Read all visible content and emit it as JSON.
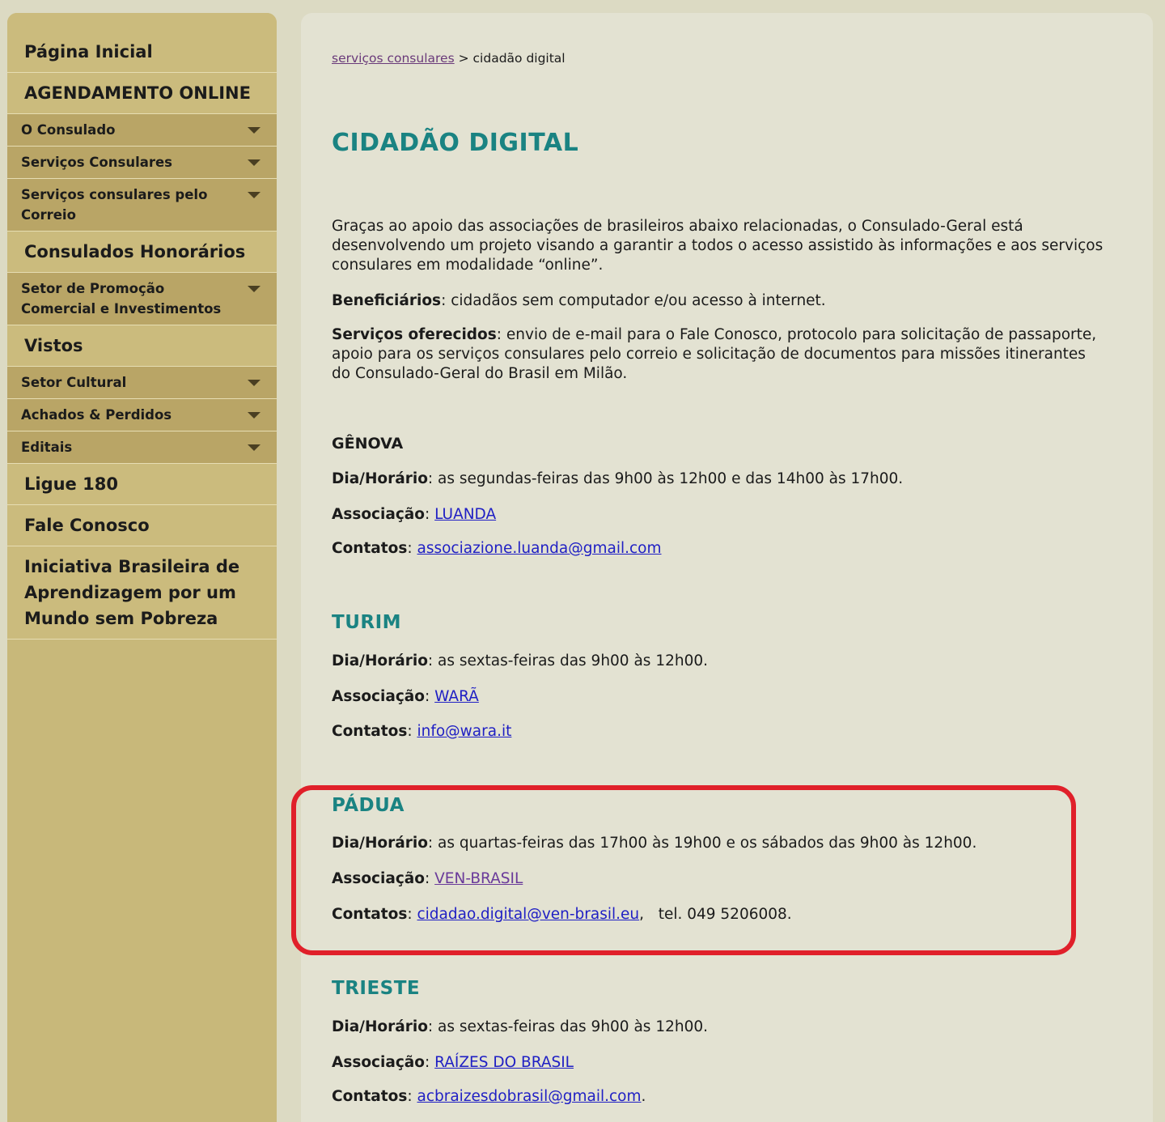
{
  "sidebar": {
    "items": [
      {
        "label": "Página Inicial",
        "type": "main"
      },
      {
        "label": "AGENDAMENTO ONLINE",
        "type": "main"
      },
      {
        "label": "O Consulado",
        "type": "sub"
      },
      {
        "label": "Serviços Consulares",
        "type": "sub"
      },
      {
        "label": "Serviços consulares pelo Correio",
        "type": "sub"
      },
      {
        "label": "Consulados Honorários",
        "type": "main"
      },
      {
        "label": "Setor de Promoção Comercial e Investimentos",
        "type": "sub"
      },
      {
        "label": "Vistos",
        "type": "main"
      },
      {
        "label": "Setor Cultural",
        "type": "sub"
      },
      {
        "label": "Achados & Perdidos",
        "type": "sub"
      },
      {
        "label": "Editais",
        "type": "sub"
      },
      {
        "label": "Ligue 180",
        "type": "main"
      },
      {
        "label": "Fale Conosco",
        "type": "main"
      },
      {
        "label": "Iniciativa Brasileira de Aprendizagem por um Mundo sem Pobreza",
        "type": "main"
      }
    ]
  },
  "breadcrumb": {
    "parent": "serviços consulares",
    "separator": ">",
    "current": "cidadão digital"
  },
  "page": {
    "title": "CIDADÃO DIGITAL",
    "intro": "Graças ao apoio das associações de brasileiros abaixo relacionadas, o Consulado-Geral está desenvolvendo um projeto visando a garantir a todos o acesso assistido às informações e aos serviços consulares em modalidade “online”.",
    "beneficiaries_label": "Beneficiários",
    "beneficiaries_text": "cidadãos sem computador e/ou acesso à internet.",
    "services_label": "Serviços oferecidos",
    "services_text": "envio de e-mail para o Fale Conosco, protocolo para solicitação de passaporte, apoio para os serviços consulares pelo correio e solicitação de documentos para missões itinerantes do Consulado-Geral do Brasil em Milão."
  },
  "labels": {
    "schedule": "Dia/Horário",
    "association": "Associação",
    "contacts": "Contatos",
    "colon": ":"
  },
  "cities": {
    "genova": {
      "name": "GÊNOVA",
      "schedule": "as segundas-feiras das 9h00 às 12h00 e das 14h00 às 17h00.",
      "association": "LUANDA",
      "email": "associazione.luanda@gmail.com"
    },
    "turim": {
      "name": "TURIM",
      "schedule": "as sextas-feiras das 9h00 às 12h00.",
      "association": "WARÃ",
      "email": "info@wara.it"
    },
    "padua": {
      "name": "PÁDUA",
      "schedule": "as quartas-feiras das 17h00 às 19h00 e os sábados das 9h00 às 12h00.",
      "association": "VEN-BRASIL",
      "email": "cidadao.digital@ven-brasil.eu",
      "phone": "tel. 049 5206008."
    },
    "trieste": {
      "name": "TRIESTE",
      "schedule": "as sextas-feiras das 9h00 às 12h00.",
      "association": "RAÍZES DO BRASIL",
      "email": "acbraizesdobrasil@gmail.com"
    }
  },
  "colors": {
    "accent": "#1a8382",
    "sidebar": "#c8b87a",
    "highlight": "#e0202a",
    "link": "#1f1fc4"
  }
}
